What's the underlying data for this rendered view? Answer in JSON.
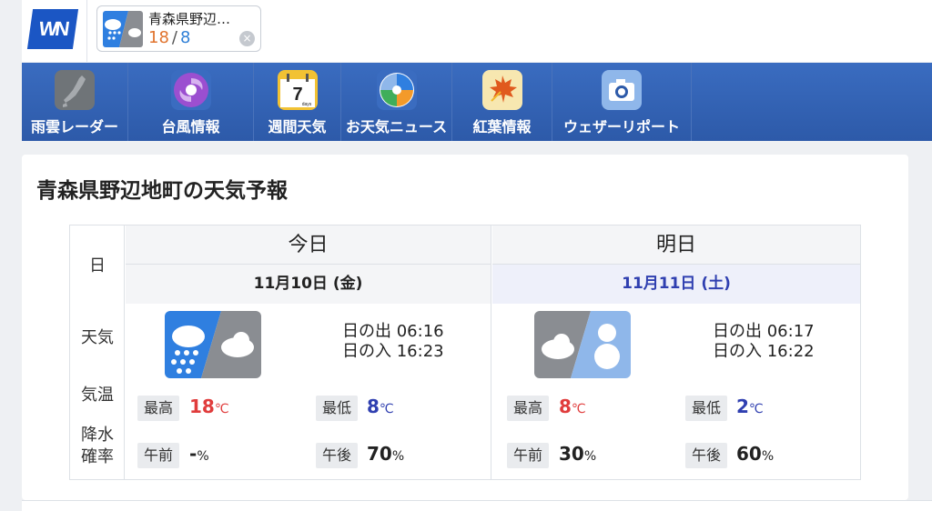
{
  "header": {
    "logo_text": "WN",
    "location_chip": {
      "name": "青森県野辺…",
      "high": "18",
      "separator": "/",
      "low": "8",
      "icon": "rain-then-cloudy-icon",
      "close_icon": "close-icon",
      "close_glyph": "×"
    }
  },
  "nav": {
    "items": [
      {
        "label": "雨雲レーダー",
        "icon": "radar-map-icon"
      },
      {
        "label": "台風情報",
        "icon": "typhoon-icon"
      },
      {
        "label": "週間天気",
        "icon": "calendar-7days-icon",
        "icon_text": "7",
        "icon_subtext": "days"
      },
      {
        "label": "お天気ニュース",
        "icon": "weather-news-icon"
      },
      {
        "label": "紅葉情報",
        "icon": "maple-leaf-icon"
      },
      {
        "label": "ウェザーリポート",
        "icon": "camera-icon"
      }
    ]
  },
  "main": {
    "title": "青森県野辺地町の天気予報",
    "row_labels": {
      "day": "日",
      "weather": "天気",
      "temperature": "気温",
      "precip_line1": "降水",
      "precip_line2": "確率"
    },
    "days": [
      {
        "label": "今日",
        "date": "11月10日 (金)",
        "weather_icon": "rain-then-cloudy-icon",
        "sunrise": "日の出 06:16",
        "sunset": "日の入 16:23",
        "high_label": "最高",
        "high": "18",
        "low_label": "最低",
        "low": "8",
        "temp_unit": "℃",
        "am_label": "午前",
        "am_precip": "-",
        "pm_label": "午後",
        "pm_precip": "70",
        "precip_unit": "%"
      },
      {
        "label": "明日",
        "date": "11月11日 (土)",
        "weather_icon": "cloudy-then-snow-icon",
        "sunrise": "日の出 06:17",
        "sunset": "日の入 16:22",
        "high_label": "最高",
        "high": "8",
        "low_label": "最低",
        "low": "2",
        "temp_unit": "℃",
        "am_label": "午前",
        "am_precip": "30",
        "pm_label": "午後",
        "pm_precip": "60",
        "precip_unit": "%"
      }
    ]
  },
  "colors": {
    "nav_bg": "#2e5cac",
    "rain_blue": "#2f7fe0",
    "cloud_grey": "#8a8d92",
    "snow_blue": "#8fb7ea",
    "high_red": "#e03c3c",
    "low_blue": "#2f3fb0",
    "chip_high_orange": "#e0732e"
  }
}
